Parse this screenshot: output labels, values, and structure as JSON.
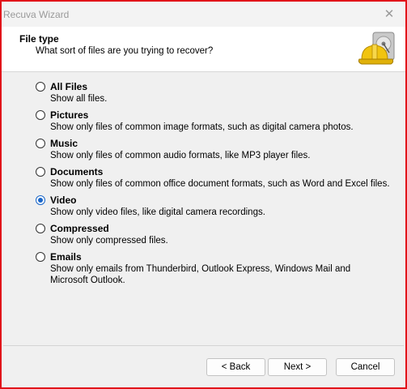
{
  "window": {
    "title": "Recuva Wizard",
    "close_symbol": "✕"
  },
  "header": {
    "title": "File type",
    "subtitle": "What sort of files are you trying to recover?",
    "icon": "recuva-hard-hat-drive-icon"
  },
  "options": [
    {
      "label": "All Files",
      "description": "Show all files.",
      "selected": false
    },
    {
      "label": "Pictures",
      "description": "Show only files of common image formats, such as digital camera photos.",
      "selected": false
    },
    {
      "label": "Music",
      "description": "Show only files of common audio formats, like MP3 player files.",
      "selected": false
    },
    {
      "label": "Documents",
      "description": "Show only files of common office document formats, such as Word and Excel files.",
      "selected": false
    },
    {
      "label": "Video",
      "description": "Show only video files, like digital camera recordings.",
      "selected": true
    },
    {
      "label": "Compressed",
      "description": "Show only compressed files.",
      "selected": false
    },
    {
      "label": "Emails",
      "description": "Show only emails from Thunderbird, Outlook Express, Windows Mail and Microsoft Outlook.",
      "selected": false
    }
  ],
  "buttons": {
    "back": "< Back",
    "next": "Next >",
    "cancel": "Cancel"
  },
  "colors": {
    "accent": "#1a66c8",
    "frame_border": "#e1141a"
  }
}
